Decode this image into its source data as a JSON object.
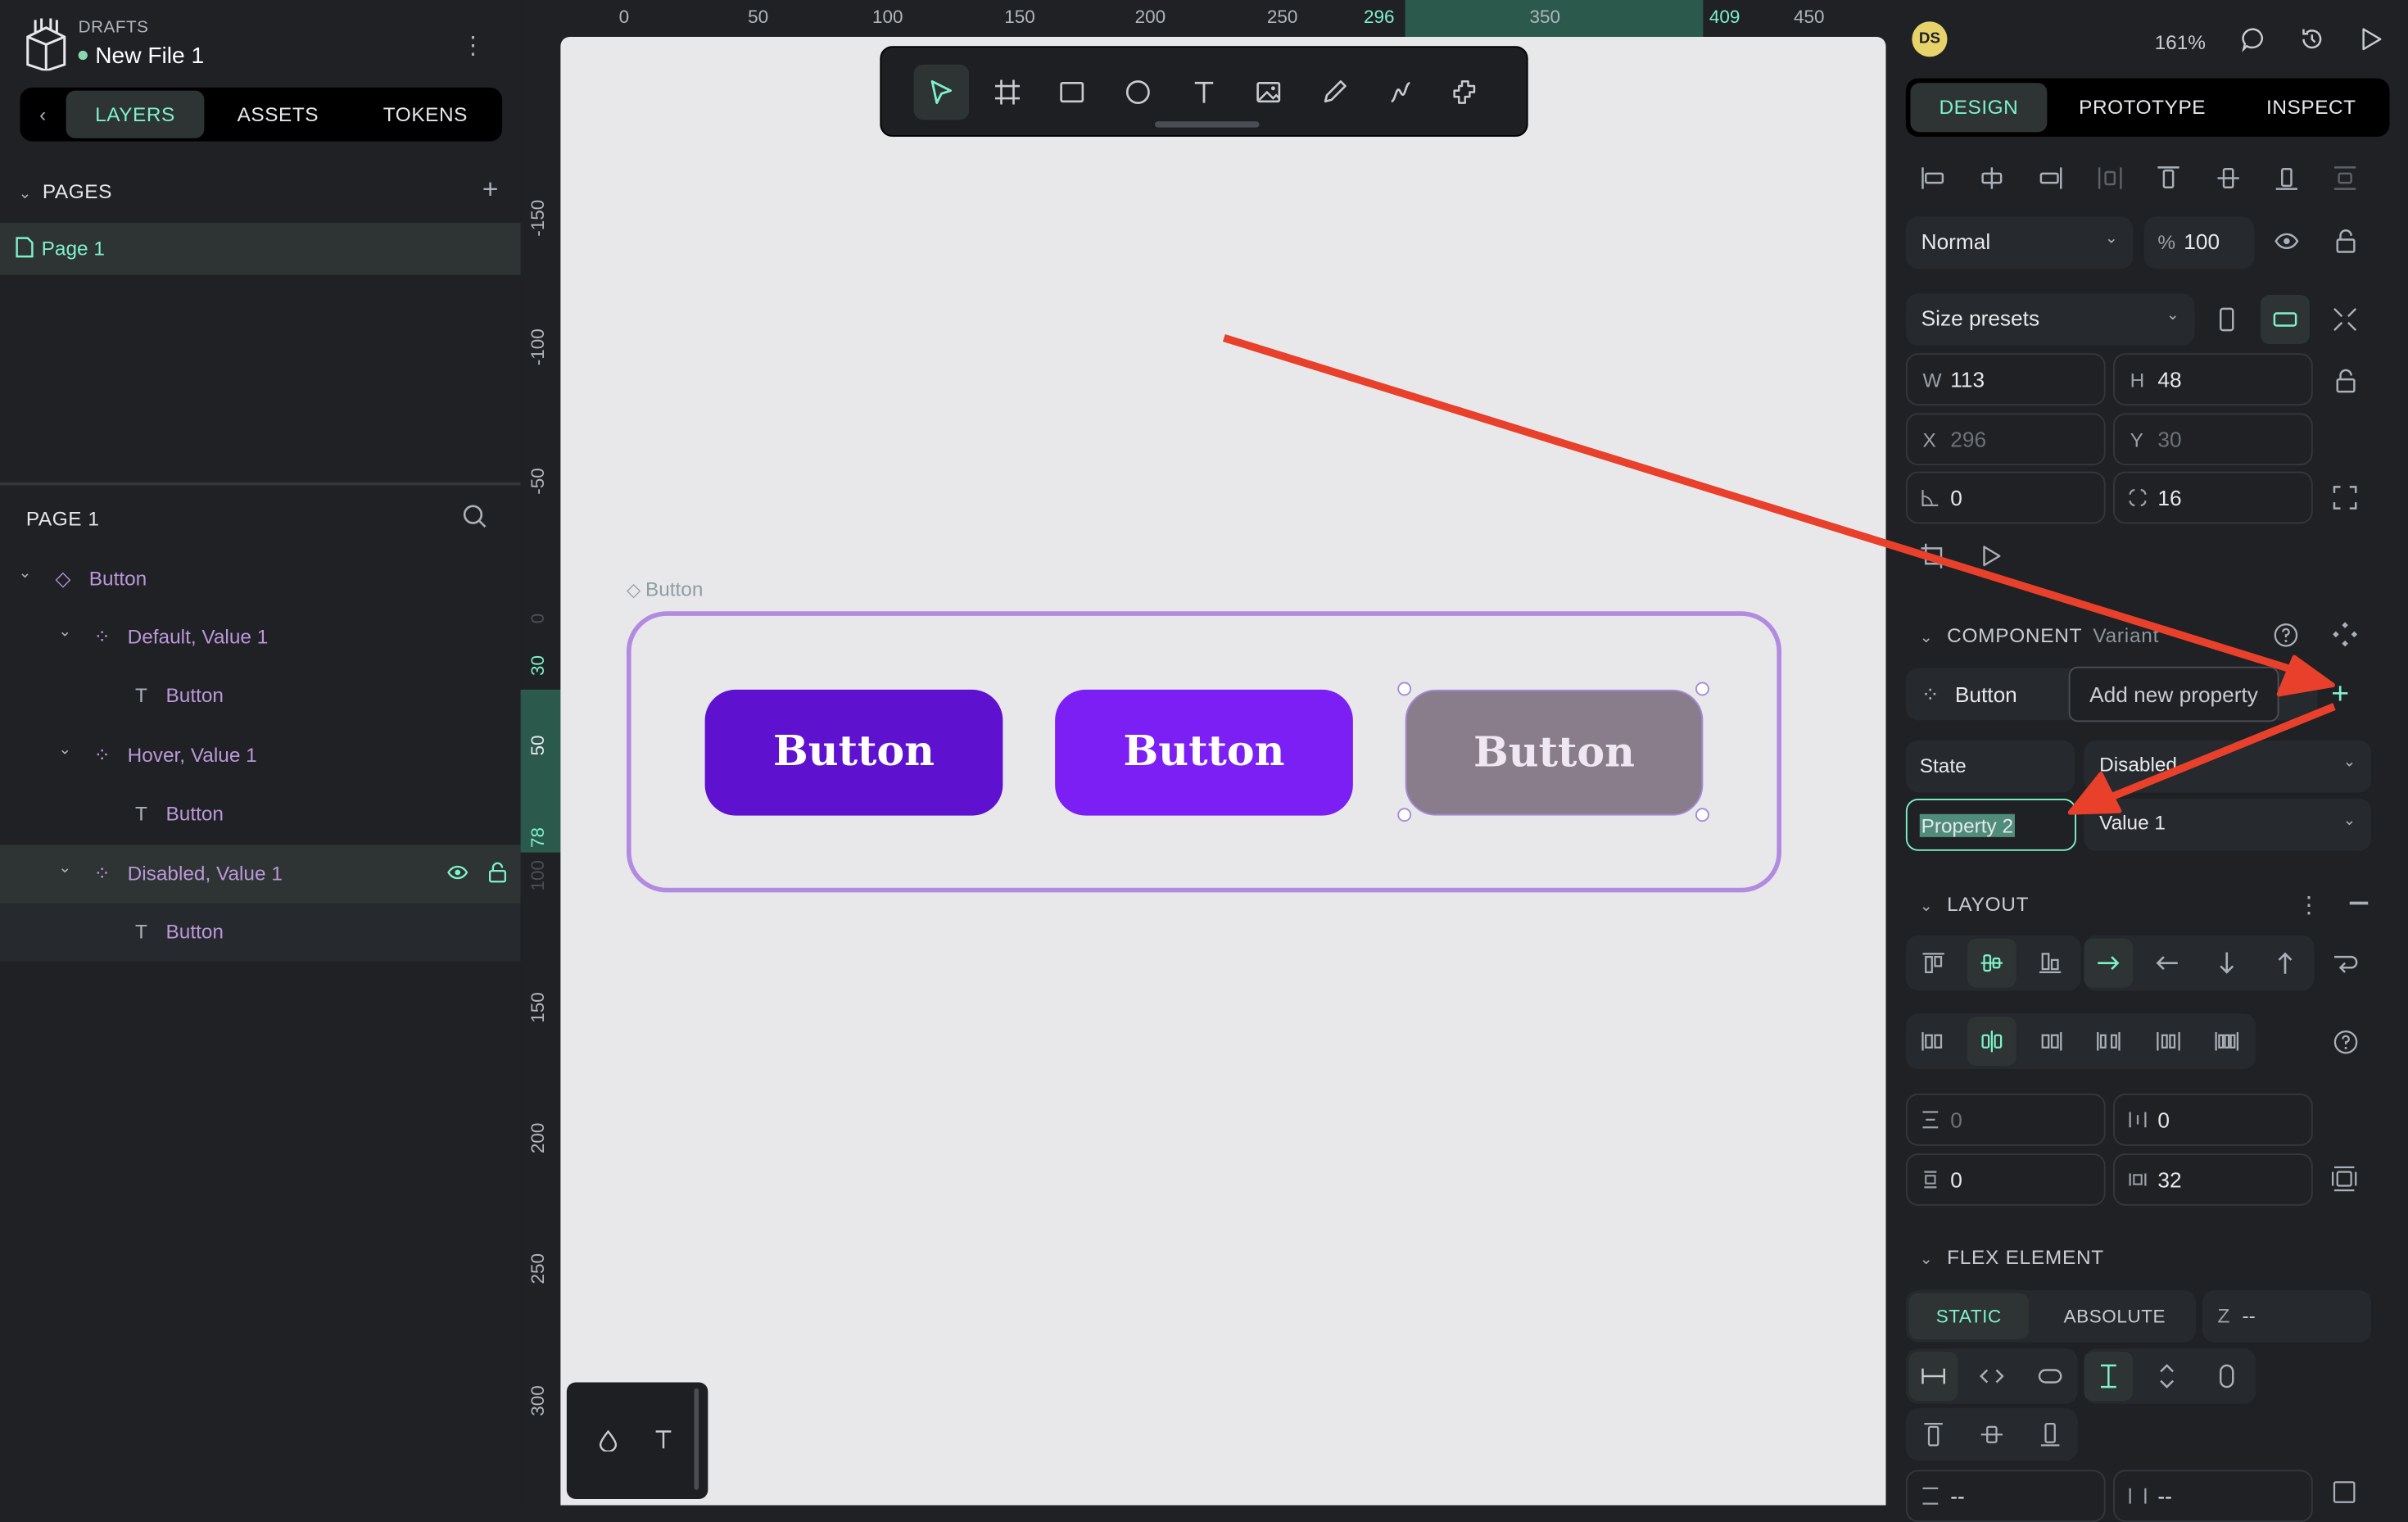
{
  "header": {
    "section": "DRAFTS",
    "file_name": "New File 1"
  },
  "left_tabs": {
    "layers": "LAYERS",
    "assets": "ASSETS",
    "tokens": "TOKENS"
  },
  "pages": {
    "title": "PAGES",
    "items": [
      {
        "label": "Page 1"
      }
    ]
  },
  "layers_panel": {
    "title": "PAGE 1",
    "items": [
      {
        "label": "Button",
        "type": "component"
      },
      {
        "label": "Default, Value 1",
        "type": "variant"
      },
      {
        "label": "Button",
        "type": "text"
      },
      {
        "label": "Hover, Value 1",
        "type": "variant"
      },
      {
        "label": "Button",
        "type": "text"
      },
      {
        "label": "Disabled, Value 1",
        "type": "variant"
      },
      {
        "label": "Button",
        "type": "text"
      }
    ]
  },
  "ruler": {
    "h_ticks": [
      "0",
      "50",
      "100",
      "150",
      "200",
      "250",
      "296",
      "350",
      "409",
      "450"
    ],
    "v_ticks": [
      "-150",
      "-100",
      "-50",
      "0",
      "30",
      "50",
      "78",
      "100",
      "150",
      "200",
      "250",
      "300"
    ]
  },
  "canvas": {
    "component_name": "Button",
    "buttons": [
      {
        "label": "Button",
        "color": "#5e12d0"
      },
      {
        "label": "Button",
        "color": "#7c1ff5"
      },
      {
        "label": "Button",
        "color": "#897d8b"
      }
    ]
  },
  "right_panel": {
    "avatar": "DS",
    "zoom": "161%",
    "tabs": {
      "design": "DESIGN",
      "prototype": "PROTOTYPE",
      "inspect": "INSPECT"
    },
    "blend_mode": "Normal",
    "opacity_symbol": "%",
    "opacity": "100",
    "size_presets": "Size presets",
    "w_label": "W",
    "w": "113",
    "h_label": "H",
    "h": "48",
    "x_label": "X",
    "x": "296",
    "y_label": "Y",
    "y": "30",
    "rotation": "0",
    "radius": "16",
    "component": {
      "title": "COMPONENT",
      "subtitle": "Variant",
      "name": "Button",
      "tooltip": "Add new property",
      "properties": [
        {
          "name": "State",
          "value": "Disabled"
        },
        {
          "name": "Property 2",
          "value": "Value 1"
        }
      ]
    },
    "layout": {
      "title": "LAYOUT",
      "row_gap": "0",
      "col_gap": "0",
      "padding_v": "0",
      "padding_h": "32"
    },
    "flex_element": {
      "title": "FLEX ELEMENT",
      "static_label": "STATIC",
      "absolute_label": "ABSOLUTE",
      "z_label": "Z",
      "z": "--",
      "min": "--",
      "max": "--"
    }
  },
  "colors": {
    "accent": "#7ef2c8",
    "component": "#bb97d8",
    "annotation_arrow": "#e8402b"
  }
}
